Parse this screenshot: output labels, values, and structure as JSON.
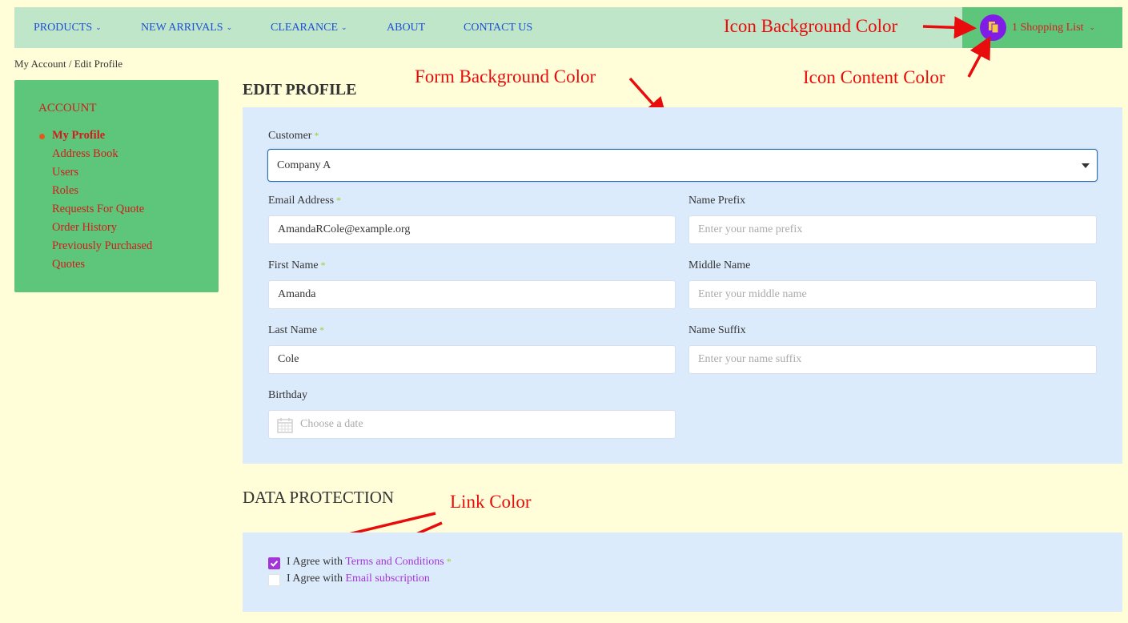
{
  "nav": {
    "items": [
      {
        "label": "PRODUCTS",
        "dropdown": true
      },
      {
        "label": "NEW ARRIVALS",
        "dropdown": true
      },
      {
        "label": "CLEARANCE",
        "dropdown": true
      },
      {
        "label": "ABOUT",
        "dropdown": false
      },
      {
        "label": "CONTACT US",
        "dropdown": false
      }
    ],
    "shopping_list": {
      "label": "1 Shopping List",
      "icon": "shopping-list-icon"
    }
  },
  "annotations": {
    "icon_bg": "Icon Background Color",
    "icon_content": "Icon Content Color",
    "form_bg": "Form Background Color",
    "link": "Link Color"
  },
  "breadcrumb": "My Account / Edit Profile",
  "sidebar": {
    "heading": "ACCOUNT",
    "items": [
      {
        "label": "My Profile",
        "active": true
      },
      {
        "label": "Address Book",
        "active": false
      },
      {
        "label": "Users",
        "active": false
      },
      {
        "label": "Roles",
        "active": false
      },
      {
        "label": "Requests For Quote",
        "active": false
      },
      {
        "label": "Order History",
        "active": false
      },
      {
        "label": "Previously Purchased",
        "active": false
      },
      {
        "label": "Quotes",
        "active": false
      }
    ]
  },
  "edit_profile": {
    "title": "EDIT PROFILE",
    "customer": {
      "label": "Customer",
      "value": "Company A"
    },
    "email": {
      "label": "Email Address",
      "value": "AmandaRCole@example.org"
    },
    "name_prefix": {
      "label": "Name Prefix",
      "placeholder": "Enter your name prefix"
    },
    "first_name": {
      "label": "First Name",
      "value": "Amanda"
    },
    "middle_name": {
      "label": "Middle Name",
      "placeholder": "Enter your middle name"
    },
    "last_name": {
      "label": "Last Name",
      "value": "Cole"
    },
    "name_suffix": {
      "label": "Name Suffix",
      "placeholder": "Enter your name suffix"
    },
    "birthday": {
      "label": "Birthday",
      "placeholder": "Choose a date"
    },
    "required_mark": "*"
  },
  "data_protection": {
    "title": "DATA PROTECTION",
    "agree_prefix": "I Agree with",
    "terms_link": "Terms and Conditions",
    "terms_checked": true,
    "email_link": "Email subscription",
    "email_checked": false
  },
  "colors": {
    "page_bg": "#fffed9",
    "nav_bg": "#bfe6c8",
    "nav_text": "#1d4fd9",
    "sidebar_bg": "#5dc67b",
    "sidebar_text": "#d21c1c",
    "form_bg": "#dcebfc",
    "icon_bg": "#7f1de6",
    "icon_content": "#f5c842",
    "link": "#a235d8",
    "annotation": "#e80c0c",
    "required_mark": "#9acd32"
  }
}
